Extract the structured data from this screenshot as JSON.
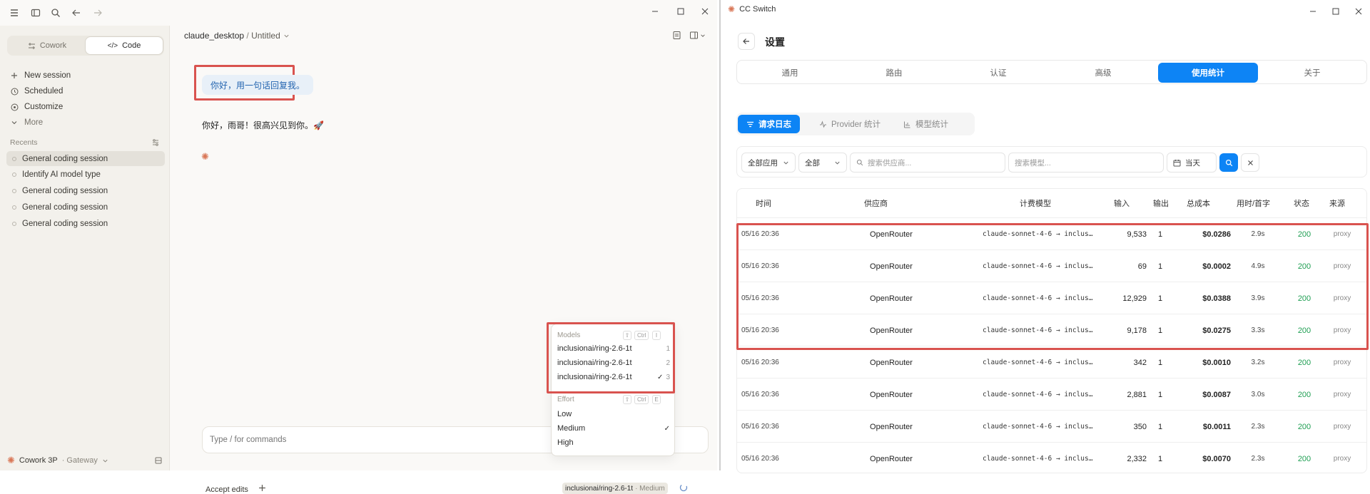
{
  "left_app": {
    "breadcrumb": {
      "project": "claude_desktop",
      "separator": " / ",
      "file": "Untitled"
    },
    "sidebar": {
      "modes": [
        "Cowork",
        "Code"
      ],
      "nav": [
        "New session",
        "Scheduled",
        "Customize",
        "More"
      ],
      "recents_label": "Recents",
      "recents": [
        "General coding session",
        "Identify AI model type",
        "General coding session",
        "General coding session",
        "General coding session"
      ],
      "footer_name": "Cowork 3P",
      "footer_sub": "· Gateway"
    },
    "chat": {
      "user_message": "你好，用一句话回复我。",
      "assistant_message": "你好，雨哥！很高兴见到你。🚀"
    },
    "composer": {
      "placeholder": "Type / for commands",
      "accept_edits": "Accept edits",
      "model_chip": "inclusionai/ring-2.6-1t",
      "effort_chip": "· Medium"
    },
    "popover": {
      "models_header": "Models",
      "models_shortcut": "Ctrl",
      "models_key": "I",
      "models": [
        {
          "name": "inclusionai/ring-2.6-1t",
          "num": "1"
        },
        {
          "name": "inclusionai/ring-2.6-1t",
          "num": "2"
        },
        {
          "name": "inclusionai/ring-2.6-1t",
          "num": "3"
        }
      ],
      "effort_header": "Effort",
      "effort_shortcut": "Ctrl",
      "effort_key": "E",
      "efforts": [
        "Low",
        "Medium",
        "High"
      ]
    }
  },
  "right_app": {
    "window_title": "CC Switch",
    "page_title": "设置",
    "tabs": [
      "通用",
      "路由",
      "认证",
      "高级",
      "使用统计",
      "关于"
    ],
    "subtabs": [
      "请求日志",
      "Provider 统计",
      "模型统计"
    ],
    "filters": {
      "app": "全部应用",
      "status": "全部",
      "provider_placeholder": "搜索供应商...",
      "model_placeholder": "搜索模型...",
      "date": "当天"
    },
    "columns": [
      "时间",
      "供应商",
      "计费模型",
      "输入",
      "输出",
      "总成本",
      "用时/首字",
      "状态",
      "来源"
    ],
    "rows": [
      [
        "05/16 20:36",
        "OpenRouter",
        "claude-sonnet-4-6 → inclus…",
        "9,533",
        "1",
        "$0.0286",
        "2.9s",
        "200",
        "proxy"
      ],
      [
        "05/16 20:36",
        "OpenRouter",
        "claude-sonnet-4-6 → inclus…",
        "69",
        "1",
        "$0.0002",
        "4.9s",
        "200",
        "proxy"
      ],
      [
        "05/16 20:36",
        "OpenRouter",
        "claude-sonnet-4-6 → inclus…",
        "12,929",
        "1",
        "$0.0388",
        "3.9s",
        "200",
        "proxy"
      ],
      [
        "05/16 20:36",
        "OpenRouter",
        "claude-sonnet-4-6 → inclus…",
        "9,178",
        "1",
        "$0.0275",
        "3.3s",
        "200",
        "proxy"
      ],
      [
        "05/16 20:36",
        "OpenRouter",
        "claude-sonnet-4-6 → inclus…",
        "342",
        "1",
        "$0.0010",
        "3.2s",
        "200",
        "proxy"
      ],
      [
        "05/16 20:36",
        "OpenRouter",
        "claude-sonnet-4-6 → inclus…",
        "2,881",
        "1",
        "$0.0087",
        "3.0s",
        "200",
        "proxy"
      ],
      [
        "05/16 20:36",
        "OpenRouter",
        "claude-sonnet-4-6 → inclus…",
        "350",
        "1",
        "$0.0011",
        "2.3s",
        "200",
        "proxy"
      ],
      [
        "05/16 20:36",
        "OpenRouter",
        "claude-sonnet-4-6 → inclus…",
        "2,332",
        "1",
        "$0.0070",
        "2.3s",
        "200",
        "proxy"
      ]
    ]
  },
  "colors": {
    "accent_blue": "#0d84f5",
    "highlight_red": "#d9534f",
    "status_green": "#1e9e52",
    "claude_orange": "#d97757"
  }
}
